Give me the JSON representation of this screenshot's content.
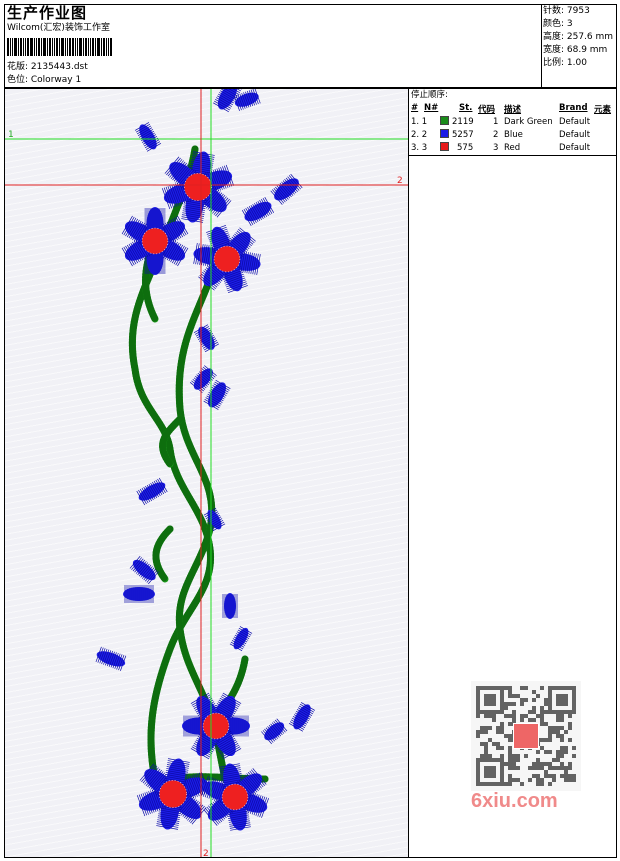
{
  "header": {
    "title": "生产作业图",
    "company": "Wilcom(汇宏)装饰工作室",
    "design_label": "花版: 2135443.dst",
    "colorway_label": "色位: Colorway 1"
  },
  "stats": {
    "stitches": "针数: 7953",
    "colors": "颜色: 3",
    "height": "高度: 257.6 mm",
    "width": "宽度: 68.9 mm",
    "scale": "比例: 1.00"
  },
  "legend": {
    "title": "停止顺序:",
    "headers": {
      "hash": "#",
      "n": "N#",
      "st": "St.",
      "code": "代码",
      "desc": "描述",
      "brand": "Brand",
      "elem": "元素"
    },
    "rows": [
      {
        "hash": "1. 1",
        "color": "#1a8c1a",
        "st": "2119",
        "code": "1",
        "desc": "Dark Green",
        "brand": "Default"
      },
      {
        "hash": "2. 2",
        "color": "#1a1ae6",
        "st": "5257",
        "code": "2",
        "desc": "Blue",
        "brand": "Default"
      },
      {
        "hash": "3. 3",
        "color": "#e61a1a",
        "st": "575",
        "code": "3",
        "desc": "Red",
        "brand": "Default"
      }
    ]
  },
  "guides": {
    "label_1": "1",
    "label_2_right": "2",
    "label_2_bottom": "2"
  },
  "watermark": {
    "text": "6xiu.com"
  },
  "colors": {
    "green": "#1a9a1a",
    "blue": "#1c1ce6",
    "red": "#ee2020",
    "guide_green": "#22dd22",
    "guide_red": "#e02020"
  }
}
